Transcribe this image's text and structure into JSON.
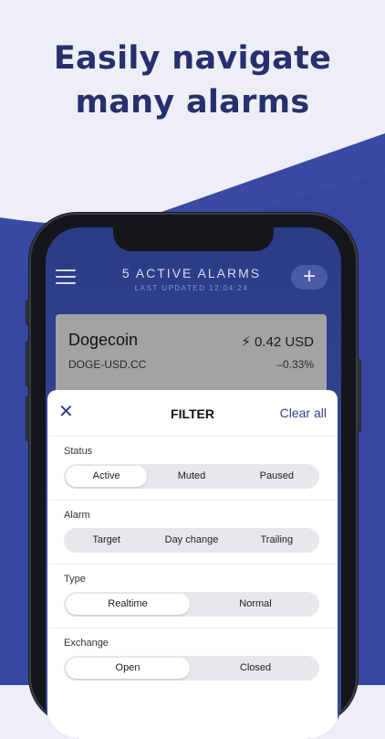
{
  "headline": {
    "line1": "Easily navigate",
    "line2": "many alarms"
  },
  "colors": {
    "headline": "#26306e",
    "accent": "#34438b",
    "background": "#eeeff6",
    "band": "#3a4aa2"
  },
  "app": {
    "title": "5 ACTIVE ALARMS",
    "subtitle": "LAST UPDATED 12:04:24",
    "menu_icon": "hamburger-menu-icon",
    "add_label": "+"
  },
  "alarm": {
    "name": "Dogecoin",
    "price": "⚡ 0.42 USD",
    "symbol": "DOGE-USD.CC",
    "change": "–0.33%"
  },
  "filter": {
    "close_label": "✕",
    "title": "FILTER",
    "clear_all": "Clear all",
    "status": {
      "label": "Status",
      "options": [
        "Active",
        "Muted",
        "Paused"
      ],
      "selected": "Active"
    },
    "alarm": {
      "label": "Alarm",
      "options": [
        "Target",
        "Day change",
        "Trailing"
      ],
      "selected": null
    },
    "type": {
      "label": "Type",
      "options": [
        "Realtime",
        "Normal"
      ],
      "selected": "Realtime"
    },
    "exchange": {
      "label": "Exchange",
      "options": [
        "Open",
        "Closed"
      ],
      "selected": "Open"
    }
  }
}
